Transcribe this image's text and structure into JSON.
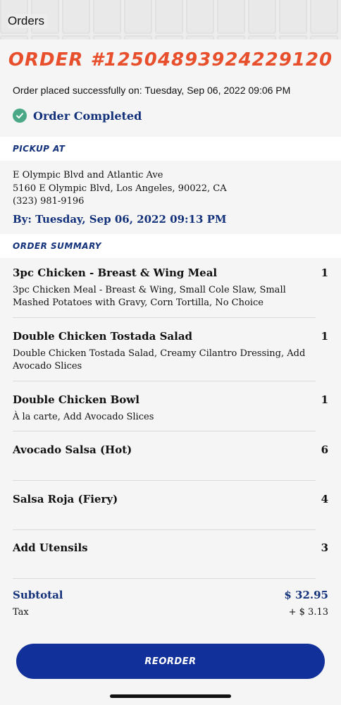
{
  "header": {
    "title": "Orders"
  },
  "order": {
    "number": "ORDER #12504893924229120",
    "placed_text": "Order placed successfully on: Tuesday, Sep 06, 2022 09:06 PM",
    "status": "Order Completed",
    "status_icon": "check-circle-icon",
    "status_color": "#4aa887"
  },
  "pickup": {
    "section_label": "PICKUP AT",
    "location_name": "E Olympic Blvd and Atlantic Ave",
    "address": "5160 E Olympic Blvd, Los Angeles, 90022, CA",
    "phone": "(323) 981-9196",
    "by": "By: Tuesday, Sep 06, 2022 09:13 PM"
  },
  "summary": {
    "section_label": "ORDER SUMMARY",
    "items": [
      {
        "name": "3pc Chicken - Breast & Wing Meal",
        "qty": "1",
        "desc": "3pc Chicken Meal - Breast & Wing, Small Cole Slaw, Small Mashed Potatoes with Gravy, Corn Tortilla, No Choice"
      },
      {
        "name": "Double Chicken Tostada Salad",
        "qty": "1",
        "desc": "Double Chicken Tostada Salad, Creamy Cilantro Dressing, Add Avocado Slices"
      },
      {
        "name": "Double Chicken Bowl",
        "qty": "1",
        "desc": "À la carte, Add Avocado Slices"
      },
      {
        "name": "Avocado Salsa (Hot)",
        "qty": "6",
        "desc": ""
      },
      {
        "name": "Salsa Roja (Fiery)",
        "qty": "4",
        "desc": ""
      },
      {
        "name": "Add Utensils",
        "qty": "3",
        "desc": ""
      }
    ]
  },
  "totals": {
    "subtotal_label": "Subtotal",
    "subtotal_value": "$ 32.95",
    "tax_label": "Tax",
    "tax_value": "+ $ 3.13"
  },
  "actions": {
    "reorder_label": "REORDER"
  },
  "colors": {
    "accent_orange": "#e8502d",
    "brand_blue": "#12317a",
    "button_blue": "#12309a"
  }
}
